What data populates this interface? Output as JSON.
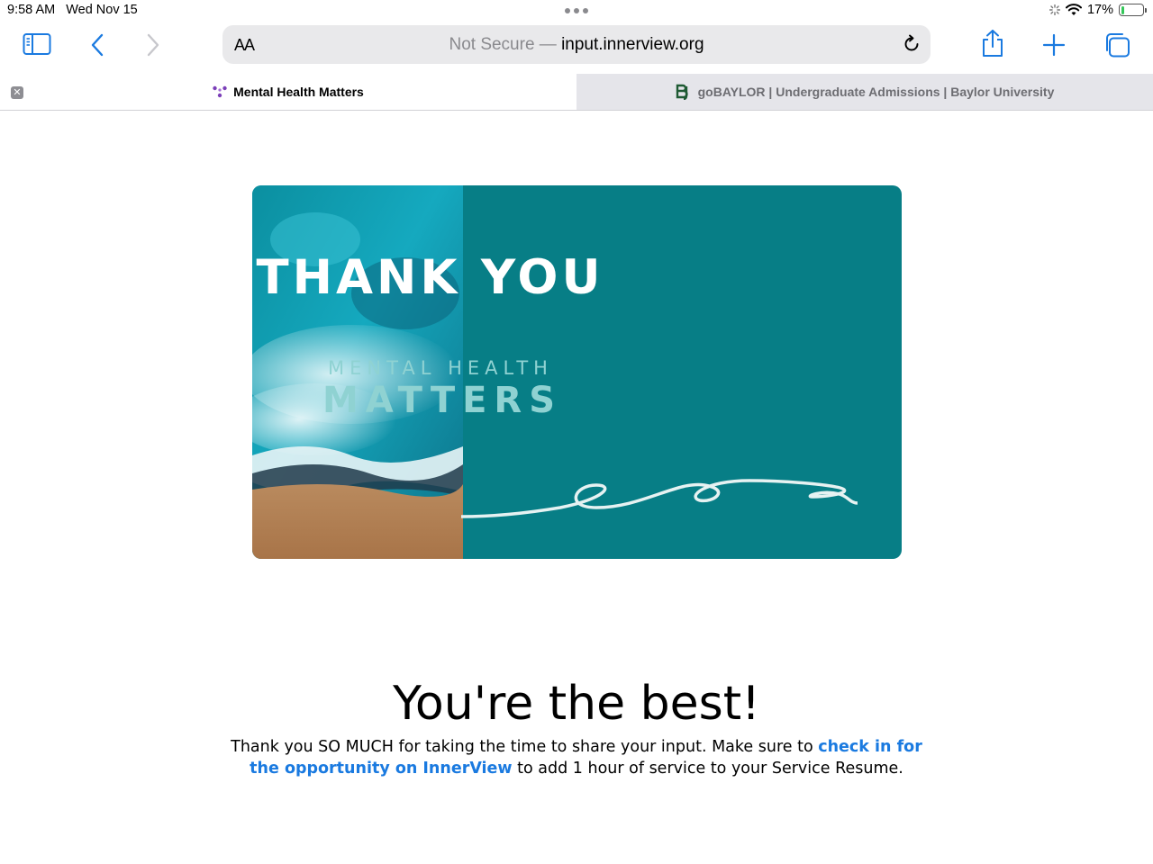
{
  "status_bar": {
    "time": "9:58 AM",
    "date": "Wed Nov 15",
    "battery": "17%",
    "battery_level": 0.17
  },
  "toolbar": {
    "text_size_label": "AA",
    "not_secure": "Not Secure —",
    "url": "input.innerview.org"
  },
  "tabs": [
    {
      "title": "Mental Health Matters",
      "active": true
    },
    {
      "title": "goBAYLOR | Undergraduate Admissions | Baylor University",
      "active": false
    }
  ],
  "card": {
    "title": "THANK YOU",
    "subtitle_1": "MENTAL HEALTH",
    "subtitle_2": "MATTERS"
  },
  "content": {
    "headline": "You're the best!",
    "message_before": "Thank you SO MUCH for taking the time to share your input. Make sure to ",
    "link_text": "check in for the opportunity on InnerView",
    "message_after": " to add 1 hour of service to your Service Resume."
  },
  "colors": {
    "accent": "#1a7ae0",
    "card_teal": "#077e86"
  }
}
